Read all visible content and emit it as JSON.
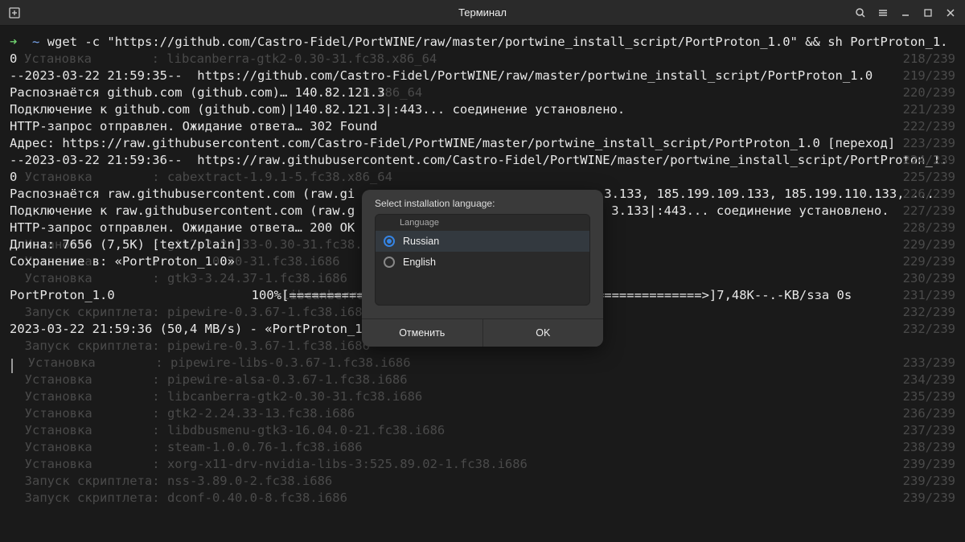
{
  "titlebar": {
    "title": "Терминал"
  },
  "prompt": {
    "command": "wget -c \"https://github.com/Castro-Fidel/PortWINE/raw/master/portwine_install_script/PortProton_1.0\" && sh PortProton_1."
  },
  "lines": {
    "l0": "0",
    "l1": "--2023-03-22 21:59:35--  https://github.com/Castro-Fidel/PortWINE/raw/master/portwine_install_script/PortProton_1.0",
    "l2": "Распознаётся github.com (github.com)… 140.82.121.3",
    "l3": "Подключение к github.com (github.com)|140.82.121.3|:443... соединение установлено.",
    "l4": "HTTP-запрос отправлен. Ожидание ответа… 302 Found",
    "l5": "Адрес: https://raw.githubusercontent.com/Castro-Fidel/PortWINE/master/portwine_install_script/PortProton_1.0 [переход]",
    "l6": "--2023-03-22 21:59:36--  https://raw.githubusercontent.com/Castro-Fidel/PortWINE/master/portwine_install_script/PortProton_1.",
    "l7": "0",
    "l8a": "Распознаётся raw.githubusercontent.com (raw.gi",
    "l8b": "3.133, 185.199.109.133, 185.199.110.133, ...",
    "l9a": "Подключение к raw.githubusercontent.com (raw.g",
    "l9b": "3.133|:443... соединение установлено.",
    "l10": "HTTP-запрос отправлен. Ожидание ответа… 200 OK",
    "l11": "Длина: 7656 (7,5K) [text/plain]",
    "l12": "Сохранение в: «PortProton_1.0»",
    "l13": "PortProton_1.0",
    "l13pct": "100%",
    "l13bar": "[=======================================================>]",
    "l13size": "7,48K",
    "l13speed": "--.-KB/s",
    "l13time": "за 0s",
    "l14": "2023-03-22 21:59:36 (50,4 MB/s) - «PortProton_1"
  },
  "dim_bg": {
    "b1": "  Установка        : libcanberra-gtk2-0.30-31.fc38.x86_64",
    "b2": "",
    "b3": "                                               8.x86_64",
    "b4": "",
    "b5": "",
    "b6": "",
    "b7": "",
    "b8": "  Установка        : cabextract-1.9.1-5.fc38.x86_64",
    "b9": "",
    "b10": "",
    "b11": "",
    "b12": "  Установка        : gtk2-2.24.33-0.30-31.fc38.i686",
    "b13": "  Установка        :       0.30-31.fc38.i686",
    "b14": "  Установка        : gtk3-3.24.37-1.fc38.i686",
    "b15": "                   : libcanberra",
    "b16": "  Запуск скриптлета: pipewire-0.3.67-1.fc38.i686",
    "b17": "  Запуск скриптлета: pipewire-0.3.67-1.fc38.i686",
    "b18": "  Установка        : pipewire-libs-0.3.67-1.fc38.i686",
    "b19": "  Установка        : pipewire-alsa-0.3.67-1.fc38.i686",
    "b20": "  Установка        : libcanberra-gtk2-0.30-31.fc38.i686",
    "b21": "  Установка        : gtk2-2.24.33-13.fc38.i686",
    "b22": "  Установка        : libdbusmenu-gtk3-16.04.0-21.fc38.i686",
    "b23": "  Установка        : steam-1.0.0.76-1.fc38.i686",
    "b24": "  Установка        : xorg-x11-drv-nvidia-libs-3:525.89.02-1.fc38.i686",
    "b25": "  Запуск скриптлета: nss-3.89.0-2.fc38.i686",
    "b26": "  Запуск скриптлета: dconf-0.40.0-8.fc38.i686"
  },
  "counts": {
    "c1": "218/239",
    "c2": "219/239",
    "c3": "220/239",
    "c4": "221/239",
    "c5": "222/239",
    "c6": "223/239",
    "c7": "224/239",
    "c8": "225/239",
    "c9": "226/239",
    "c10": "227/239",
    "c11": "228/239",
    "c12": "229/239",
    "c13": "229/239",
    "c14": "230/239",
    "c15": "231/239",
    "c16": "232/239",
    "c17": "232/239",
    "c18": "233/239",
    "c19": "234/239",
    "c20": "235/239",
    "c21": "236/239",
    "c22": "237/239",
    "c23": "238/239",
    "c24": "239/239",
    "c25": "239/239",
    "c26": "239/239"
  },
  "dialog": {
    "title": "Select installation language:",
    "lang_header": "Language",
    "options": {
      "0": "Russian",
      "1": "English"
    },
    "cancel": "Отменить",
    "ok": "OK"
  }
}
